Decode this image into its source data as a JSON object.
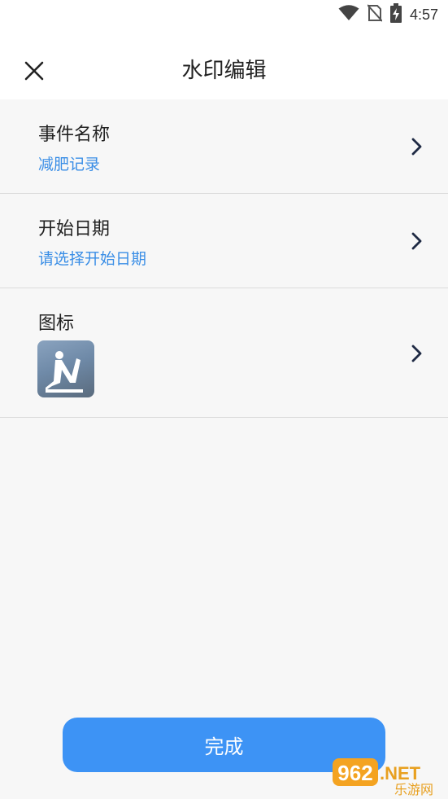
{
  "status_bar": {
    "time": "4:57"
  },
  "header": {
    "title": "水印编辑"
  },
  "rows": [
    {
      "title": "事件名称",
      "value": "减肥记录"
    },
    {
      "title": "开始日期",
      "value": "请选择开始日期"
    },
    {
      "title": "图标"
    }
  ],
  "footer": {
    "done_label": "完成"
  },
  "colors": {
    "accent": "#3d93f5",
    "link": "#3a8ee6",
    "background": "#f7f7f7"
  },
  "watermark": {
    "number": "962",
    "suffix": ".NET",
    "label": "乐游网"
  }
}
